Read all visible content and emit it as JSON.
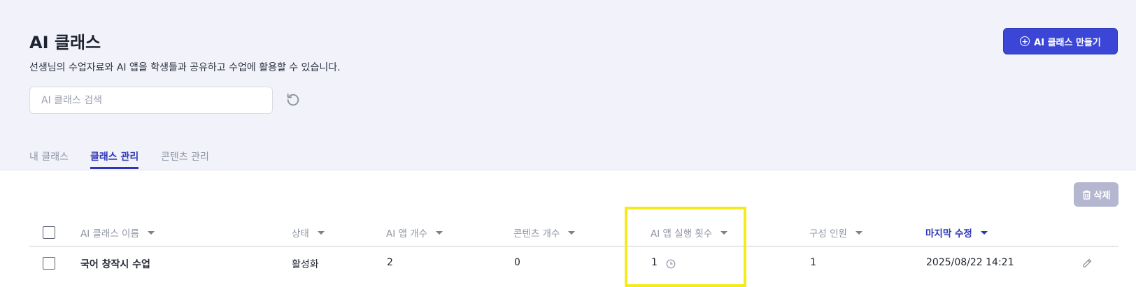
{
  "header": {
    "title": "AI 클래스",
    "subtitle": "선생님의 수업자료와 AI 앱을 학생들과 공유하고 수업에 활용할 수 있습니다.",
    "create_button_label": "AI 클래스 만들기",
    "create_button_icon": "plus-circle-icon"
  },
  "search": {
    "placeholder": "AI 클래스 검색",
    "value": "",
    "refresh_icon": "refresh-icon"
  },
  "tabs": [
    {
      "label": "내 클래스",
      "active": false
    },
    {
      "label": "클래스 관리",
      "active": true
    },
    {
      "label": "콘텐츠 관리",
      "active": false
    }
  ],
  "toolbar": {
    "delete_label": "삭제",
    "delete_icon": "trash-icon",
    "delete_enabled": false
  },
  "table": {
    "columns": [
      {
        "label": "AI 클래스 이름",
        "sorted": false
      },
      {
        "label": "상태",
        "sorted": false
      },
      {
        "label": "AI 앱 개수",
        "sorted": false
      },
      {
        "label": "콘텐츠 개수",
        "sorted": false
      },
      {
        "label": "AI 앱 실행 횟수",
        "sorted": false
      },
      {
        "label": "구성 인원",
        "sorted": false
      },
      {
        "label": "마지막 수정",
        "sorted": true
      }
    ],
    "rows": [
      {
        "name": "국어 창작시 수업",
        "status": "활성화",
        "app_count": "2",
        "content_count": "0",
        "run_count": "1",
        "member_count": "1",
        "last_modified": "2025/08/22 14:21"
      }
    ]
  },
  "colors": {
    "accent": "#3b46d6",
    "background_top": "#f2f3fa",
    "highlight": "#f7ea1c",
    "disabled_button": "#b4b7cf"
  }
}
